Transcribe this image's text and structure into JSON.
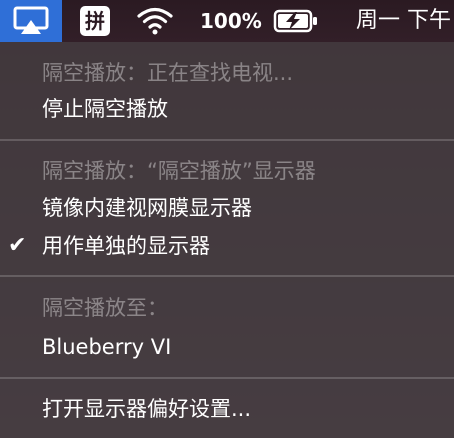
{
  "menubar": {
    "ime_label": "拼",
    "battery_percent": "100%",
    "clock": "周一 下午"
  },
  "menu": {
    "sections": [
      {
        "header": "隔空播放：正在查找电视...",
        "items": [
          "停止隔空播放"
        ]
      },
      {
        "header": "隔空播放：“隔空播放”显示器",
        "items": [
          "镜像内建视网膜显示器",
          "用作单独的显示器"
        ],
        "checked_item": "用作单独的显示器"
      },
      {
        "header": "隔空播放至：",
        "items": [
          "Blueberry VI"
        ]
      },
      {
        "items": [
          "打开显示器偏好设置..."
        ]
      }
    ],
    "checkmark": "✔"
  }
}
